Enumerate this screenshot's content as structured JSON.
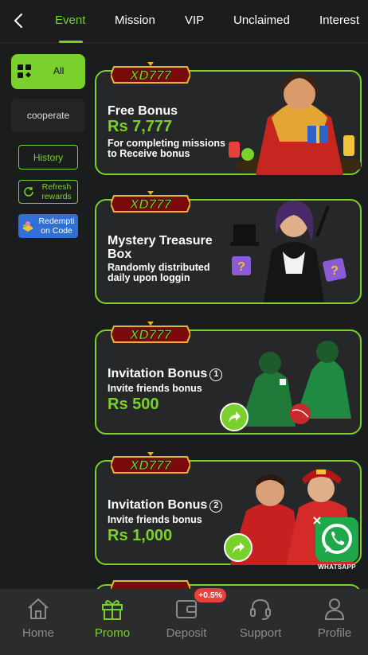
{
  "nav": {
    "tabs": [
      {
        "label": "Event",
        "active": true
      },
      {
        "label": "Mission"
      },
      {
        "label": "VIP"
      },
      {
        "label": "Unclaimed"
      },
      {
        "label": "Interest"
      }
    ]
  },
  "sidebar": {
    "all_label": "All",
    "cooperate_label": "cooperate",
    "history_label": "History",
    "refresh_label": "Refresh rewards",
    "redeem_label": "Redempti on Code"
  },
  "logo_text": "XD777",
  "cards": [
    {
      "title": "Free Bonus",
      "amount": "Rs 7,777",
      "desc": "For completing missions to Receive bonus"
    },
    {
      "title": "Mystery Treasure Box",
      "amount": "",
      "desc": "Randomly distributed daily upon loggin"
    },
    {
      "title": "Invitation Bonus",
      "number": "1",
      "amount": "Rs 500",
      "desc": "Invite friends bonus"
    },
    {
      "title": "Invitation Bonus",
      "number": "2",
      "amount": "Rs 1,000",
      "desc": "Invite friends bonus"
    }
  ],
  "whatsapp_label": "WHATSAPP",
  "bottom_nav": {
    "items": [
      {
        "label": "Home"
      },
      {
        "label": "Promo",
        "active": true
      },
      {
        "label": "Deposit"
      },
      {
        "label": "Support"
      },
      {
        "label": "Profile"
      }
    ],
    "deposit_badge": "+0.5%"
  },
  "colors": {
    "accent": "#7ad12c",
    "background": "#1b1c1d",
    "badge": "#e8403b",
    "redeem": "#2f6fd6"
  }
}
